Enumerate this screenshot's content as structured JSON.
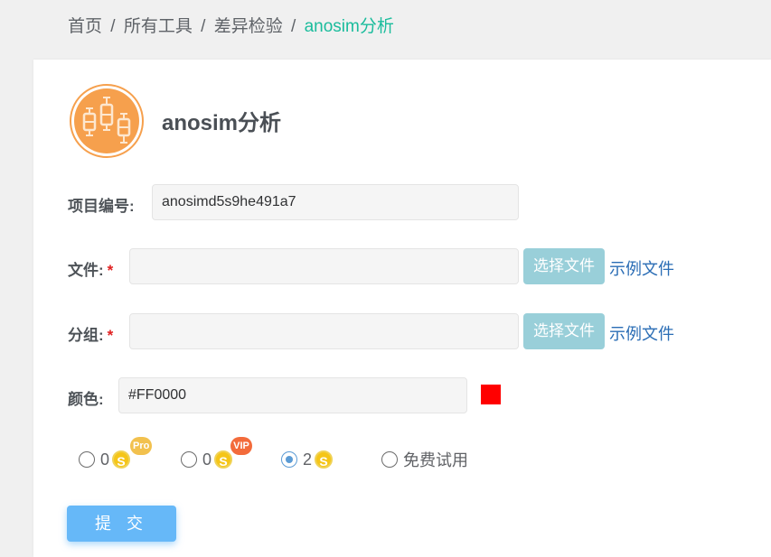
{
  "breadcrumb": {
    "home": "首页",
    "all_tools": "所有工具",
    "category": "差异检验",
    "current": "anosim分析",
    "separator": "/"
  },
  "tool": {
    "title": "anosim分析",
    "icon": "boxplot-icon",
    "icon_color": "#f6a04d"
  },
  "form": {
    "project_id": {
      "label": "项目编号:",
      "value": "anosimd5s9he491a7"
    },
    "file": {
      "label": "文件:",
      "required_mark": "*",
      "value": "",
      "choose_button": "选择文件",
      "example_link": "示例文件"
    },
    "group": {
      "label": "分组:",
      "required_mark": "*",
      "value": "",
      "choose_button": "选择文件",
      "example_link": "示例文件"
    },
    "color": {
      "label": "颜色:",
      "value": "#FF0000",
      "swatch": "#FF0000"
    }
  },
  "pricing_options": [
    {
      "amount": "0",
      "coin": "S",
      "badge": "Pro",
      "checked": false
    },
    {
      "amount": "0",
      "coin": "S",
      "badge": "VIP",
      "checked": false
    },
    {
      "amount": "2",
      "coin": "S",
      "badge": "",
      "checked": true
    },
    {
      "label": "免费试用",
      "checked": false
    }
  ],
  "submit_label": "提 交",
  "colors": {
    "accent": "#1abc9c",
    "submit": "#66b8f8",
    "file_button": "#99cfd9",
    "link": "#2a6db5",
    "coin": "#f5c518"
  }
}
